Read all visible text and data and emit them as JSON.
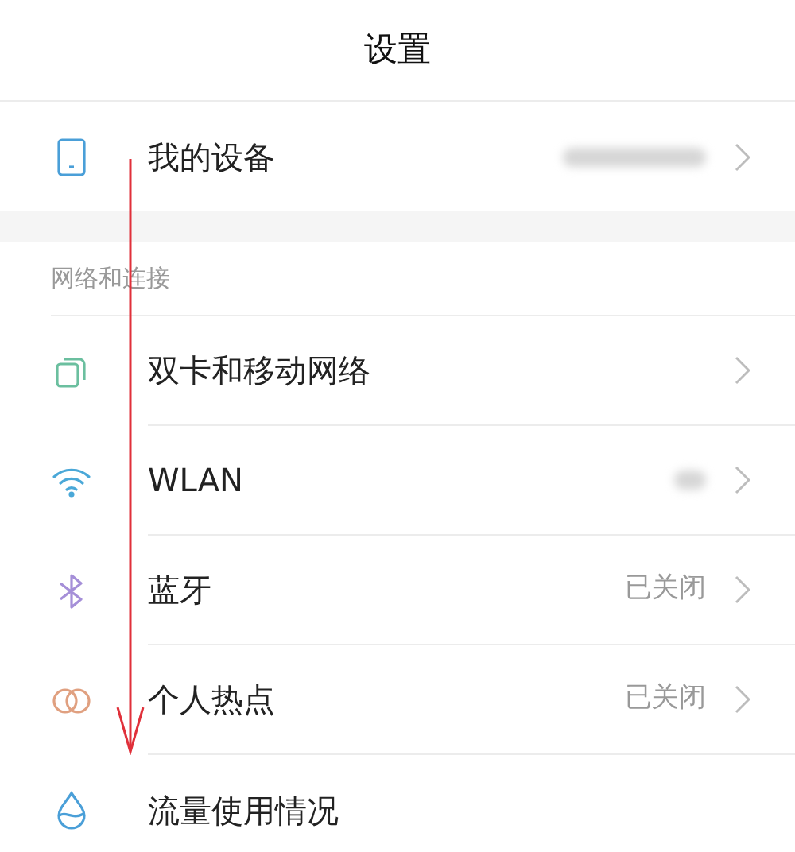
{
  "header": {
    "title": "设置"
  },
  "top_rows": [
    {
      "label": "我的设备",
      "value_blurred": true,
      "chevron": true
    }
  ],
  "section": {
    "title": "网络和连接"
  },
  "rows": [
    {
      "label": "双卡和移动网络",
      "chevron": true
    },
    {
      "label": "WLAN",
      "value_blurred": true,
      "chevron": true
    },
    {
      "label": "蓝牙",
      "value": "已关闭",
      "chevron": true
    },
    {
      "label": "个人热点",
      "value": "已关闭",
      "chevron": true
    },
    {
      "label": "流量使用情况",
      "chevron": false
    }
  ]
}
